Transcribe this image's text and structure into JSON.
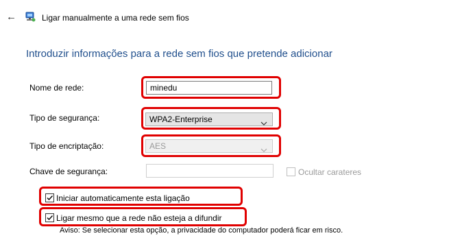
{
  "window": {
    "title": "Ligar manualmente a uma rede sem fios"
  },
  "heading": "Introduzir informações para a rede sem fios que pretende adicionar",
  "form": {
    "network_name_label": "Nome de rede:",
    "network_name_value": "minedu",
    "security_type_label": "Tipo de segurança:",
    "security_type_value": "WPA2-Enterprise",
    "encryption_type_label": "Tipo de encriptação:",
    "encryption_type_value": "AES",
    "security_key_label": "Chave de segurança:",
    "security_key_value": "",
    "hide_characters_label": "Ocultar carateres",
    "hide_characters_checked": false,
    "auto_start_label": "Iniciar automaticamente esta ligação",
    "auto_start_checked": true,
    "connect_hidden_label": "Ligar mesmo que a rede não esteja a difundir",
    "connect_hidden_checked": true,
    "warning_text": "Aviso: Se selecionar esta opção, a privacidade do computador poderá ficar em risco."
  },
  "colors": {
    "heading": "#1f4e8c",
    "highlight": "#e00000"
  },
  "icons": {
    "back": "back-arrow-icon",
    "network": "network-icon",
    "dropdown": "chevron-down-icon",
    "check": "check-icon"
  }
}
